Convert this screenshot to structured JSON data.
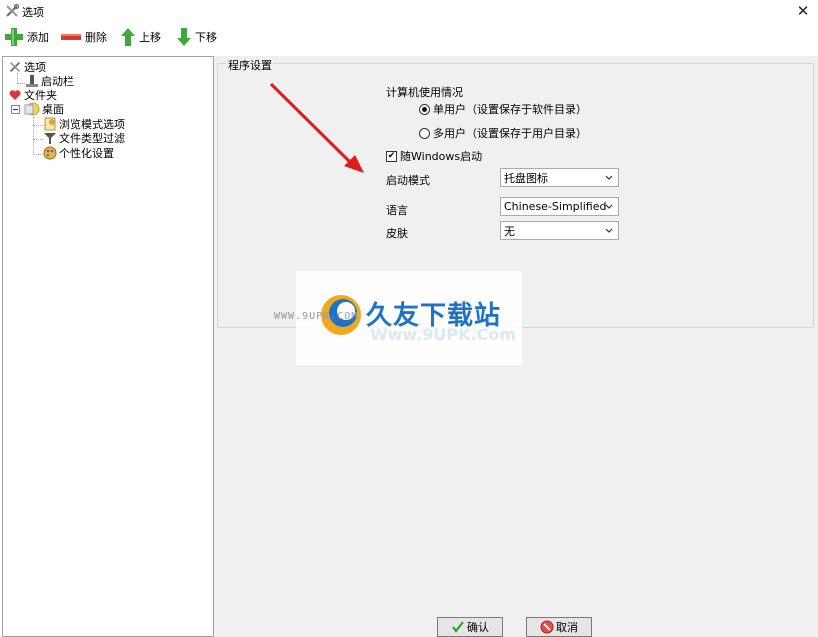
{
  "window": {
    "title": "选项",
    "close_glyph": "✕"
  },
  "toolbar": {
    "add_label": "添加",
    "delete_label": "删除",
    "move_up_label": "上移",
    "move_down_label": "下移"
  },
  "tree": {
    "root": "选项",
    "launch_bar": "启动栏",
    "folder": "文件夹",
    "desktop": "桌面",
    "browse_mode": "浏览模式选项",
    "file_filter": "文件类型过滤",
    "personalize": "个性化设置"
  },
  "settings": {
    "group_title": "程序设置",
    "usage_label": "计算机使用情况",
    "single_user": "单用户（设置保存于软件目录）",
    "multi_user": "多用户（设置保存于用户目录）",
    "usage_selected": "single_user",
    "startup_label": "随Windows启动",
    "startup_checked": true,
    "launch_mode_label": "启动模式",
    "launch_mode_value": "托盘图标",
    "language_label": "语言",
    "language_value": "Chinese-Simplified",
    "skin_label": "皮肤",
    "skin_value": "无"
  },
  "buttons": {
    "ok_label": "确认",
    "cancel_label": "取消"
  },
  "watermark": {
    "url": "WWW.9UPK.COM",
    "title": "久友下载站",
    "subtitle": "Www.9UPK.Com"
  },
  "colors": {
    "annotation_arrow": "#e01b1b",
    "watermark_blue": "#1f73c7"
  }
}
